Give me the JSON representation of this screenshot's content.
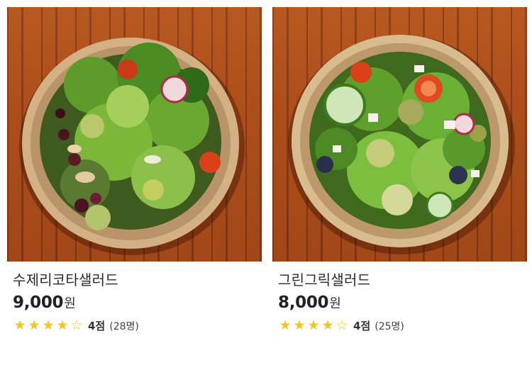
{
  "products": [
    {
      "name": "수제리코타샐러드",
      "price": "9,000",
      "currency": "원",
      "rating": 4,
      "rating_max": 5,
      "score_label": "4점",
      "review_count": "(28명)",
      "image_alt": "수제리코타샐러드"
    },
    {
      "name": "그린그릭샐러드",
      "price": "8,000",
      "currency": "원",
      "rating": 4,
      "rating_max": 5,
      "score_label": "4점",
      "review_count": "(25명)",
      "image_alt": "그린그릭샐러드"
    }
  ],
  "icons": {
    "star_filled": "star-filled-icon",
    "star_empty": "star-empty-icon"
  },
  "colors": {
    "star": "#f5c518",
    "wood": "#a64715",
    "bowl": "#d8b98c"
  }
}
